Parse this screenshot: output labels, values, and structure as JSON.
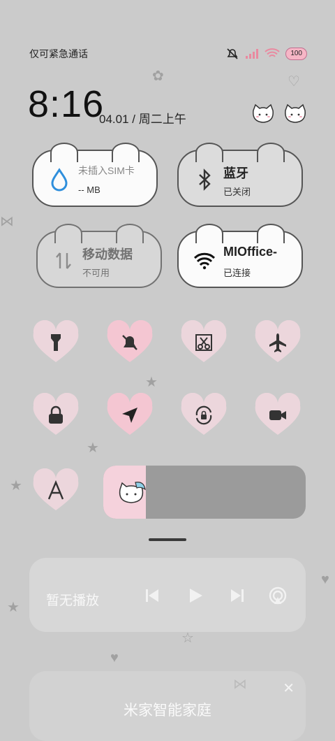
{
  "status_bar": {
    "carrier": "仅可紧急通话",
    "battery": "100",
    "icons": [
      "mute-icon",
      "signal-icon",
      "wifi-icon",
      "battery-icon"
    ]
  },
  "clock": {
    "time": "8:16",
    "date": "04.01 / 周二上午"
  },
  "tiles": {
    "data_usage": {
      "title": "未插入SIM卡",
      "sub": "-- MB",
      "icon": "water-drop-icon"
    },
    "bluetooth": {
      "title": "蓝牙",
      "sub": "已关闭",
      "icon": "bluetooth-icon"
    },
    "mobile_data": {
      "title": "移动数据",
      "sub": "不可用",
      "icon": "mobile-data-icon"
    },
    "wifi": {
      "title": "MIOffice-",
      "sub": "已连接",
      "icon": "wifi-icon"
    }
  },
  "toggles": [
    {
      "name": "flashlight",
      "icon": "flashlight-icon",
      "active": false
    },
    {
      "name": "mute",
      "icon": "bell-off-icon",
      "active": true
    },
    {
      "name": "screenshot",
      "icon": "scissors-icon",
      "active": false
    },
    {
      "name": "airplane",
      "icon": "airplane-icon",
      "active": false
    },
    {
      "name": "lock",
      "icon": "lock-icon",
      "active": false
    },
    {
      "name": "location",
      "icon": "location-icon",
      "active": true
    },
    {
      "name": "auto-rotate",
      "icon": "rotate-lock-icon",
      "active": false
    },
    {
      "name": "screen-record",
      "icon": "video-icon",
      "active": false
    },
    {
      "name": "font",
      "icon": "font-a-icon",
      "active": false
    }
  ],
  "brightness": {
    "level": 0.21
  },
  "media": {
    "label": "暂无播放",
    "icons": [
      "previous-icon",
      "play-icon",
      "next-icon",
      "cast-icon"
    ]
  },
  "smart_home": {
    "title": "米家智能家庭",
    "close": "✕"
  },
  "colors": {
    "background": "#cbcbcb",
    "heart_pink": "#f4c6d2",
    "heart_light": "#ecd6dc",
    "accent_blue": "#2f8fdc"
  }
}
